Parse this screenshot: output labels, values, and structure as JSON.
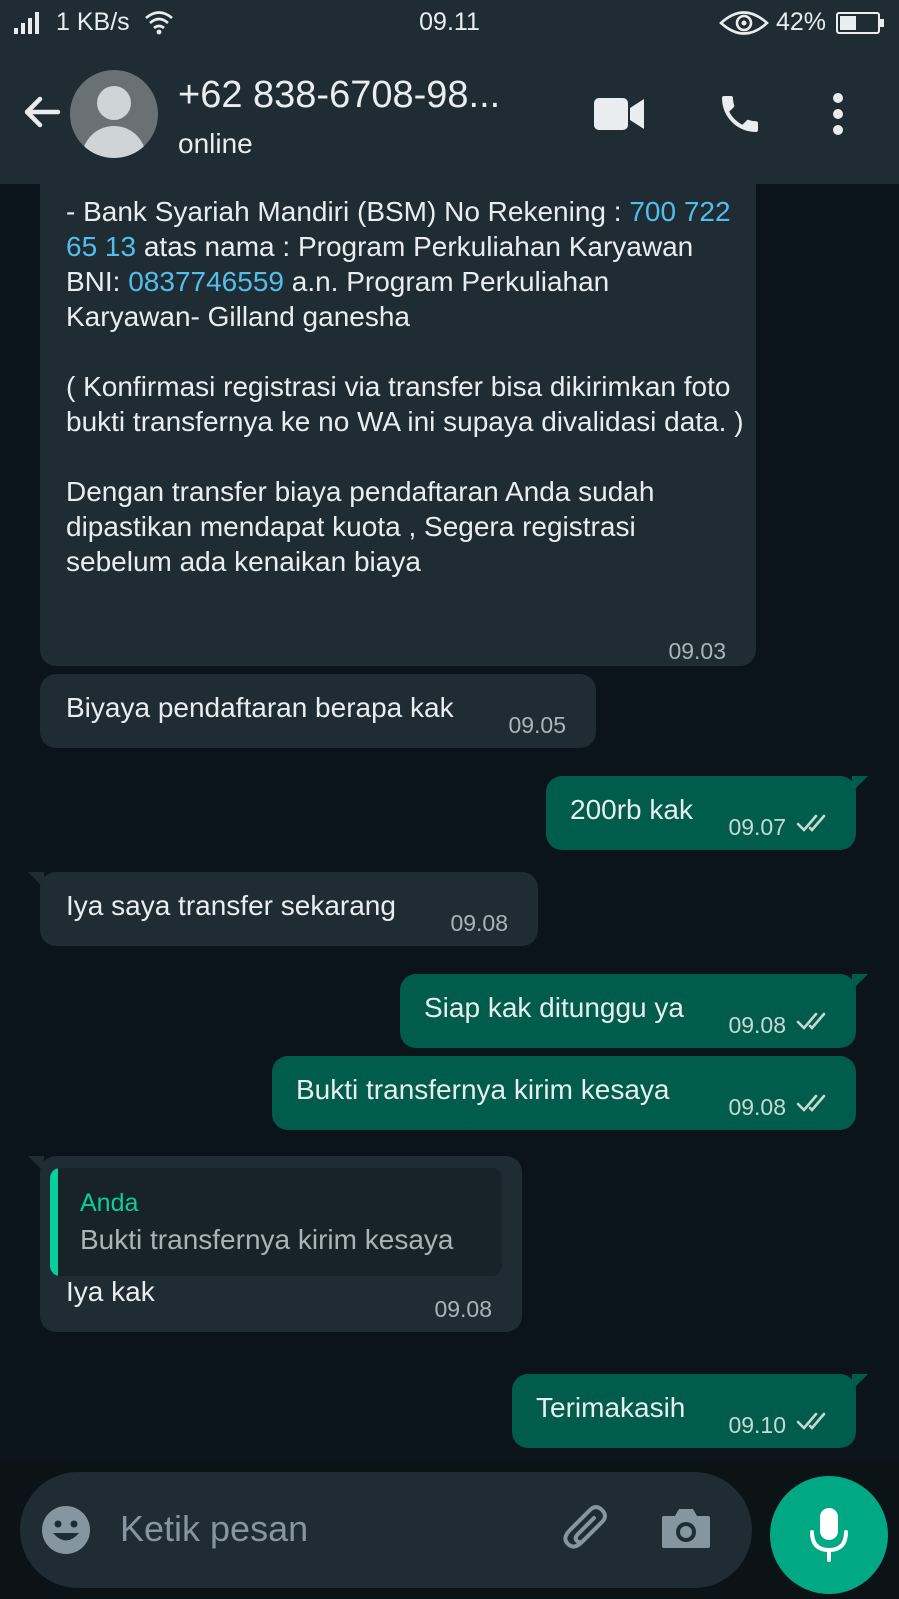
{
  "status_bar": {
    "speed": "1 KB/s",
    "time": "09.11",
    "battery": "42%"
  },
  "header": {
    "contact_name": "+62 838-6708-98...",
    "status": "online"
  },
  "messages": [
    {
      "direction": "incoming",
      "segments": [
        {
          "text": "- Bank Syariah Mandiri (BSM) No Rekening : "
        },
        {
          "text": "700 722 65 13",
          "link": true
        },
        {
          "text": " atas nama : Program Perkuliahan Karyawan\nBNI:  "
        },
        {
          "text": "0837746559",
          "link": true
        },
        {
          "text": " a.n. Program Perkuliahan Karyawan- Gilland ganesha\n\n( Konfirmasi registrasi via transfer bisa dikirimkan foto bukti transfernya ke no WA ini supaya divalidasi data. )\n\nDengan transfer biaya pendaftaran Anda sudah dipastikan mendapat kuota , Segera registrasi sebelum ada kenaikan biaya"
        }
      ],
      "time": "09.03"
    },
    {
      "direction": "incoming",
      "text": "Biyaya pendaftaran berapa kak",
      "time": "09.05"
    },
    {
      "direction": "outgoing",
      "text": "200rb kak",
      "time": "09.07",
      "read": true
    },
    {
      "direction": "incoming",
      "text": "Iya saya transfer sekarang",
      "time": "09.08"
    },
    {
      "direction": "outgoing",
      "text": "Siap kak ditunggu ya",
      "time": "09.08",
      "read": true
    },
    {
      "direction": "outgoing",
      "text": "Bukti transfernya kirim kesaya",
      "time": "09.08",
      "read": true
    },
    {
      "direction": "incoming",
      "quote": {
        "author": "Anda",
        "text": "Bukti transfernya kirim kesaya"
      },
      "text": "Iya kak",
      "time": "09.08"
    },
    {
      "direction": "outgoing",
      "text": "Terimakasih",
      "time": "09.10",
      "read": true
    }
  ],
  "composer": {
    "placeholder": "Ketik pesan"
  },
  "icons": {
    "back": "arrow-left-icon",
    "video": "video-call-icon",
    "call": "phone-icon",
    "menu": "more-vert-icon",
    "emoji": "emoji-icon",
    "attach": "paperclip-icon",
    "camera": "camera-icon",
    "mic": "mic-icon"
  },
  "colors": {
    "header_bg": "#1f2c34",
    "incoming_bubble": "#1f2c34",
    "outgoing_bubble": "#005c4b",
    "link": "#53bdeb",
    "accent": "#00a884",
    "quote_accent": "#06cf9c"
  }
}
